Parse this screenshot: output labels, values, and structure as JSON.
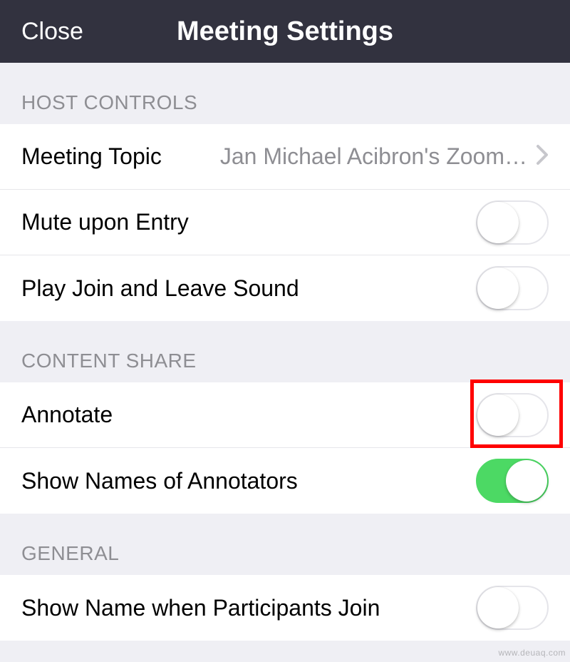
{
  "header": {
    "close_label": "Close",
    "title": "Meeting Settings"
  },
  "sections": {
    "host_controls": {
      "title": "HOST CONTROLS",
      "meeting_topic": {
        "label": "Meeting Topic",
        "value": "Jan Michael Acibron's Zoom…"
      },
      "mute_upon_entry": {
        "label": "Mute upon Entry",
        "on": false
      },
      "play_join_leave_sound": {
        "label": "Play Join and Leave Sound",
        "on": false
      }
    },
    "content_share": {
      "title": "CONTENT SHARE",
      "annotate": {
        "label": "Annotate",
        "on": false,
        "highlighted": true
      },
      "show_names_annotators": {
        "label": "Show Names of Annotators",
        "on": true
      }
    },
    "general": {
      "title": "GENERAL",
      "show_name_participants_join": {
        "label": "Show Name when Participants Join",
        "on": false
      }
    }
  },
  "watermark": "www.deuaq.com",
  "colors": {
    "header_bg": "#32323f",
    "toggle_on": "#4cd964",
    "highlight": "#ff0000"
  }
}
